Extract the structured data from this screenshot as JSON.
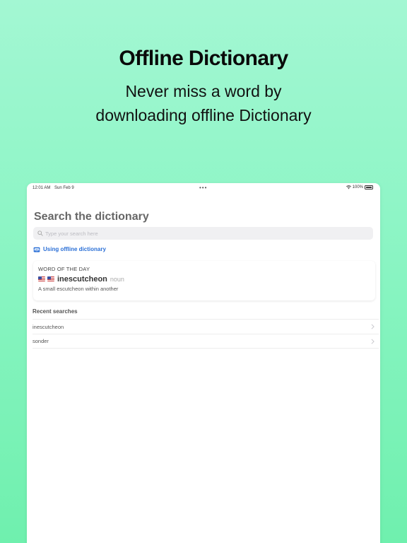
{
  "headline": "Offline Dictionary",
  "subtitle": "Never miss a word by downloading offline Dictionary",
  "status_bar": {
    "time": "12:01 AM",
    "date": "Sun Feb 9",
    "dots": "•••",
    "battery": "100%"
  },
  "screen": {
    "title": "Search the dictionary",
    "search": {
      "placeholder": "Type your search here",
      "value": ""
    },
    "offline_label": "Using offline dictionary",
    "word_of_the_day": {
      "heading": "WORD OF THE DAY",
      "word": "inescutcheon",
      "part_of_speech": "noun",
      "definition": "A small escutcheon within another"
    },
    "recent": {
      "title": "Recent searches",
      "items": [
        {
          "label": "inescutcheon"
        },
        {
          "label": "sonder"
        }
      ]
    }
  },
  "colors": {
    "accent": "#2a6fd6",
    "background_top": "#a3f7d3",
    "background_bottom": "#6ff0ae"
  },
  "icons": [
    "search-icon",
    "tray-icon",
    "flag-icon",
    "chevron-right-icon",
    "wifi-icon",
    "battery-icon"
  ]
}
